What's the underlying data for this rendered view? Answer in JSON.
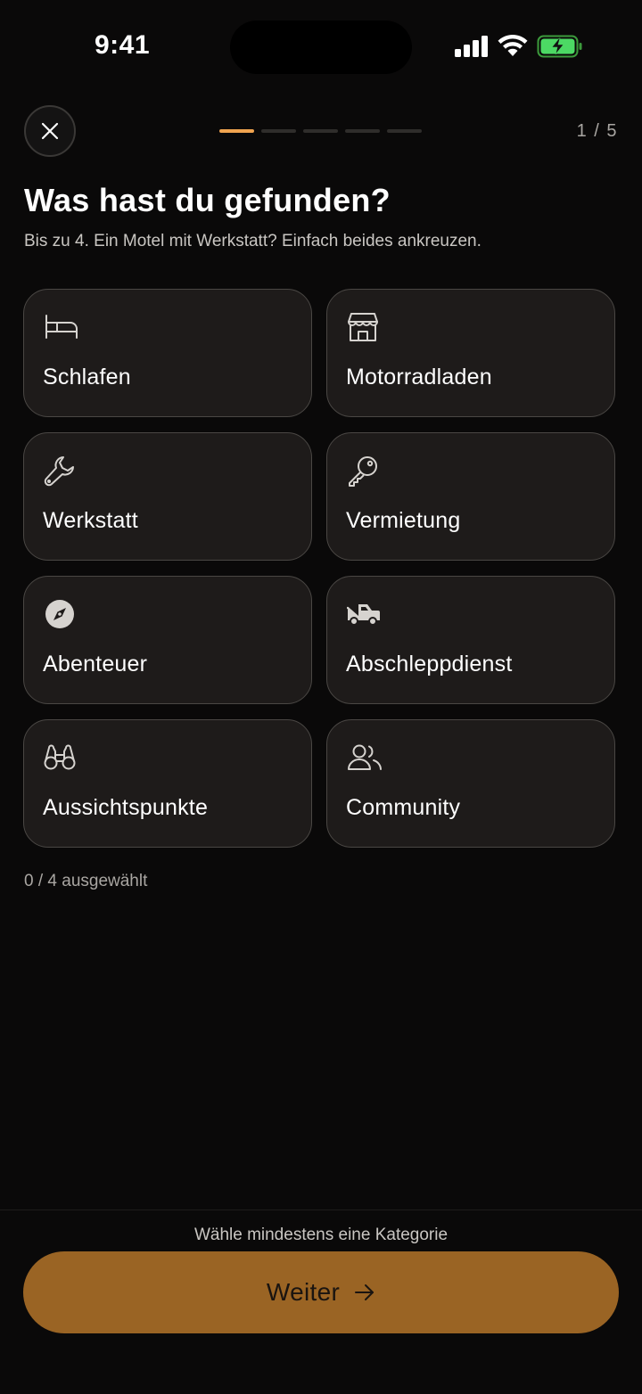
{
  "status_bar": {
    "time": "9:41"
  },
  "header": {
    "step_counter": "1 / 5",
    "progress": {
      "total_steps": 5,
      "current_step": 1
    }
  },
  "title": "Was hast du gefunden?",
  "subtitle": "Bis zu 4. Ein Motel mit Werkstatt? Einfach beides ankreuzen.",
  "categories": [
    {
      "label": "Schlafen",
      "icon": "bed-icon"
    },
    {
      "label": "Motorradladen",
      "icon": "store-icon"
    },
    {
      "label": "Werkstatt",
      "icon": "wrench-icon"
    },
    {
      "label": "Vermietung",
      "icon": "key-icon"
    },
    {
      "label": "Abenteuer",
      "icon": "compass-icon"
    },
    {
      "label": "Abschleppdienst",
      "icon": "tow-truck-icon"
    },
    {
      "label": "Aussichtspunkte",
      "icon": "binoculars-icon"
    },
    {
      "label": "Community",
      "icon": "users-icon"
    }
  ],
  "selection_count": "0 / 4 ausgewählt",
  "footer": {
    "hint": "Wähle mindestens eine Kategorie",
    "continue_label": "Weiter"
  },
  "colors": {
    "accent": "#f0a450",
    "button": "#9a6424",
    "card_bg": "#1e1b1a",
    "page_bg": "#0a0909"
  }
}
